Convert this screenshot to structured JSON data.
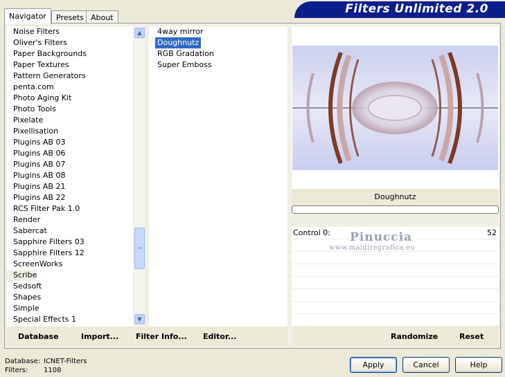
{
  "banner": {
    "title": "Filters Unlimited 2.0"
  },
  "tabs": [
    {
      "label": "Navigator",
      "active": true
    },
    {
      "label": "Presets",
      "active": false
    },
    {
      "label": "About",
      "active": false
    }
  ],
  "categories": [
    "Noise Filters",
    "Oliver's Filters",
    "Paper Backgrounds",
    "Paper Textures",
    "Pattern Generators",
    "penta.com",
    "Photo Aging Kit",
    "Photo Tools",
    "Pixelate",
    "Pixellisation",
    "Plugins AB 03",
    "Plugins AB 06",
    "Plugins AB 07",
    "Plugins AB 08",
    "Plugins AB 21",
    "Plugins AB 22",
    "RCS Filter Pak 1.0",
    "Render",
    "Sabercat",
    "Sapphire Filters 03",
    "Sapphire Filters 12",
    "ScreenWorks",
    "Scribe",
    "Sedsoft",
    "Shapes",
    "Simple",
    "Special Effects 1"
  ],
  "selected_category": "Scribe",
  "filters": [
    "4way mirror",
    "Doughnutz",
    "RGB Gradation",
    "Super Emboss"
  ],
  "selected_filter": "Doughnutz",
  "preview": {
    "filter_name": "Doughnutz"
  },
  "controls": [
    {
      "label": "Control 0:",
      "value": "52"
    }
  ],
  "watermark": {
    "name": "Pinuccia",
    "site": "www.maidiregrafica.eu"
  },
  "bottom_links": {
    "database": "Database",
    "import": "Import...",
    "filter_info": "Filter Info...",
    "editor": "Editor...",
    "randomize": "Randomize",
    "reset": "Reset"
  },
  "status": {
    "database_label": "Database:",
    "database_value": "ICNET-Filters",
    "filters_label": "Filters:",
    "filters_value": "1108"
  },
  "buttons": {
    "apply": "Apply",
    "cancel": "Cancel",
    "help": "Help"
  },
  "colors": {
    "banner": "#0b1f8c",
    "selection": "#316ac5",
    "panel": "#ece9d8"
  }
}
